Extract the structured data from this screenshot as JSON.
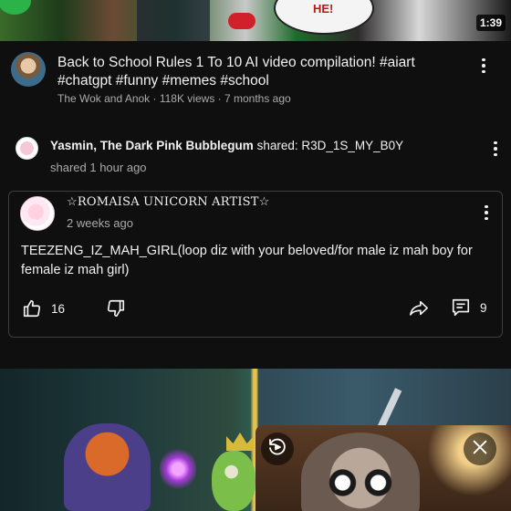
{
  "top_video": {
    "duration": "1:39",
    "thumbnail_caption": "HE!"
  },
  "video": {
    "title": "Back to School Rules 1 To 10 AI video compilation! #aiart #chatgpt #funny #memes #school",
    "meta": "The Wok and Anok · 118K views · 7 months ago"
  },
  "shared_post": {
    "sharer_name": "Yasmin, The Dark Pink Bubblegum",
    "shared_text": " shared: R3D_1S_MY_B0Y",
    "time": "shared 1 hour ago"
  },
  "post": {
    "author": "☆ROMAISA UNICORN ARTIST☆",
    "time": "2 weeks ago",
    "body": "TEEZENG_IZ_MAH_GIRL(loop diz with your beloved/for male iz mah boy for female iz mah girl)",
    "likes": "16",
    "comments": "9"
  },
  "icons": {
    "more": "more-vert-icon",
    "like": "thumbs-up-icon",
    "dislike": "thumbs-down-icon",
    "share": "share-icon",
    "comment": "comment-icon",
    "replay": "replay-icon",
    "close": "close-icon"
  }
}
